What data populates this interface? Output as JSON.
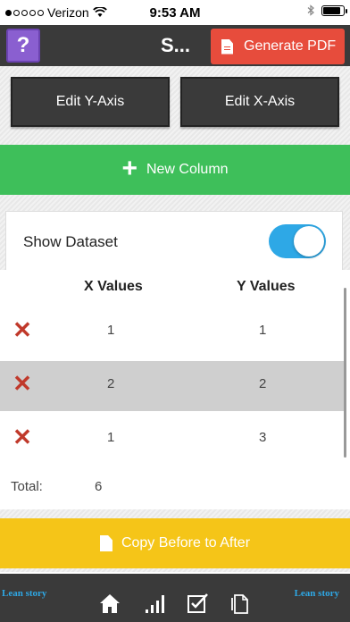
{
  "status_bar": {
    "carrier": "Verizon",
    "time": "9:53 AM",
    "signal_dots_filled": 1,
    "signal_dots_total": 5,
    "battery_level": 0.9
  },
  "header": {
    "help_label": "?",
    "title": "S...",
    "pdf_button_label": "Generate PDF"
  },
  "axis_buttons": {
    "edit_y": "Edit Y-Axis",
    "edit_x": "Edit X-Axis"
  },
  "new_column_label": "New Column",
  "dataset": {
    "label": "Show Dataset",
    "enabled": true
  },
  "table": {
    "headers": [
      "X Values",
      "Y Values"
    ],
    "rows": [
      {
        "x": "1",
        "y": "1"
      },
      {
        "x": "2",
        "y": "2"
      },
      {
        "x": "1",
        "y": "3"
      }
    ],
    "total_label": "Total:",
    "total_value": "6"
  },
  "copy_button_label": "Copy Before to After",
  "bottom_bar": {
    "brand_left": "Lean story",
    "brand_right": "Lean story"
  },
  "colors": {
    "header_bg": "#3a3a3a",
    "help_purple": "#8a5fd0",
    "pdf_red": "#e74c3c",
    "green": "#3ebf5a",
    "toggle_blue": "#2ea8e6",
    "delete_red": "#c0392b",
    "yellow": "#f5c518"
  }
}
